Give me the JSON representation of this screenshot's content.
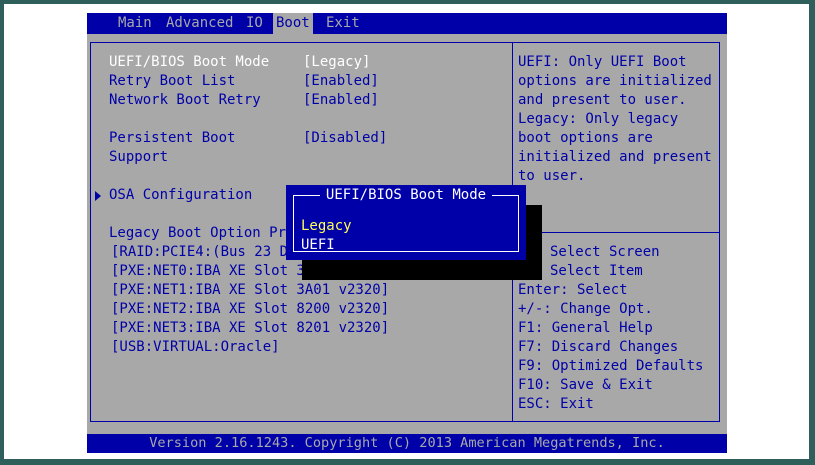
{
  "menu": {
    "items": [
      {
        "label": "Main",
        "active": false
      },
      {
        "label": "Advanced",
        "active": false
      },
      {
        "label": "IO",
        "active": false
      },
      {
        "label": "Boot",
        "active": true
      },
      {
        "label": "Exit",
        "active": false
      }
    ]
  },
  "settings": {
    "boot_mode_label": "UEFI/BIOS Boot Mode",
    "boot_mode_value": "[Legacy]",
    "retry_label": "Retry Boot List",
    "retry_value": "[Enabled]",
    "network_retry_label": "Network Boot Retry",
    "network_retry_value": "[Enabled]",
    "persistent_label_1": "Persistent Boot",
    "persistent_label_2": "Support",
    "persistent_value": "[Disabled]",
    "osa_label": "OSA Configuration",
    "legacy_priority_label": "Legacy Boot Option Pri",
    "boot_options": [
      "[RAID:PCIE4:(Bus 23 De",
      "[PXE:NET0:IBA XE Slot 3A",
      "[PXE:NET1:IBA XE Slot 3A01 v2320]",
      "[PXE:NET2:IBA XE Slot 8200 v2320]",
      "[PXE:NET3:IBA XE Slot 8201 v2320]",
      "[USB:VIRTUAL:Oracle]"
    ]
  },
  "help": {
    "lines": [
      "UEFI: Only UEFI Boot",
      "options are initialized",
      "and present to user.",
      "Legacy: Only legacy",
      "boot options are",
      "initialized and present",
      "to user."
    ]
  },
  "keys": {
    "lines": [
      "Select Screen",
      "Select Item",
      "Enter: Select",
      "+/-: Change Opt.",
      "F1: General Help",
      "F7: Discard Changes",
      "F9: Optimized Defaults",
      "F10: Save & Exit",
      "ESC: Exit"
    ]
  },
  "popup": {
    "title": "UEFI/BIOS Boot Mode",
    "options": [
      "Legacy",
      "UEFI"
    ],
    "selected": "Legacy"
  },
  "footer": {
    "text": "Version 2.16.1243. Copyright (C) 2013 American Megatrends, Inc."
  },
  "colors": {
    "bios_blue": "#0000a8",
    "bios_gray": "#a8a8a8",
    "highlight_yellow": "#ffff55",
    "text_white": "#ffffff"
  }
}
